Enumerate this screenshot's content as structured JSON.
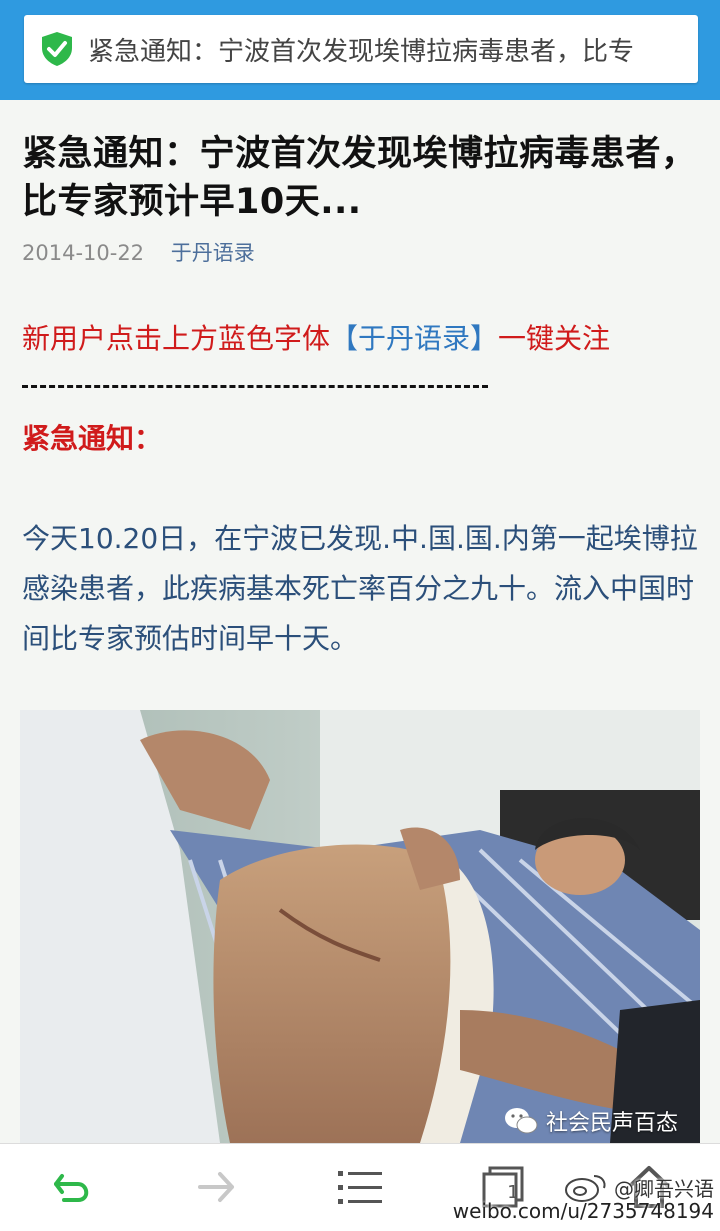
{
  "browser": {
    "url_title": "紧急通知：宁波首次发现埃博拉病毒患者，比专",
    "secure_color": "#2eb84a",
    "bar_color": "#2f9ae0"
  },
  "article": {
    "title": "紧急通知：宁波首次发现埃博拉病毒患者，比专家预计早10天...",
    "date": "2014-10-22",
    "author": "于丹语录",
    "promo_prefix": "新用户点击上方蓝色字体",
    "promo_link": "【于丹语录】",
    "promo_suffix": "一键关注",
    "notice_title": "紧急通知：",
    "paragraph": "今天10.20日，在宁波已发现.中.国.国.内第一起埃博拉感染患者，此疾病基本死亡率百分之九十。流入中国时间比专家预估时间早十天。",
    "image_watermark": "社会民声百态"
  },
  "toolbar": {
    "back_icon": "back-arrow-icon",
    "forward_icon": "forward-arrow-icon",
    "menu_icon": "menu-icon",
    "tabs_count": "1",
    "home_icon": "home-icon"
  },
  "overlay": {
    "weibo_handle": "@卿吾兴语",
    "weibo_url": "weibo.com/u/2735748194"
  }
}
